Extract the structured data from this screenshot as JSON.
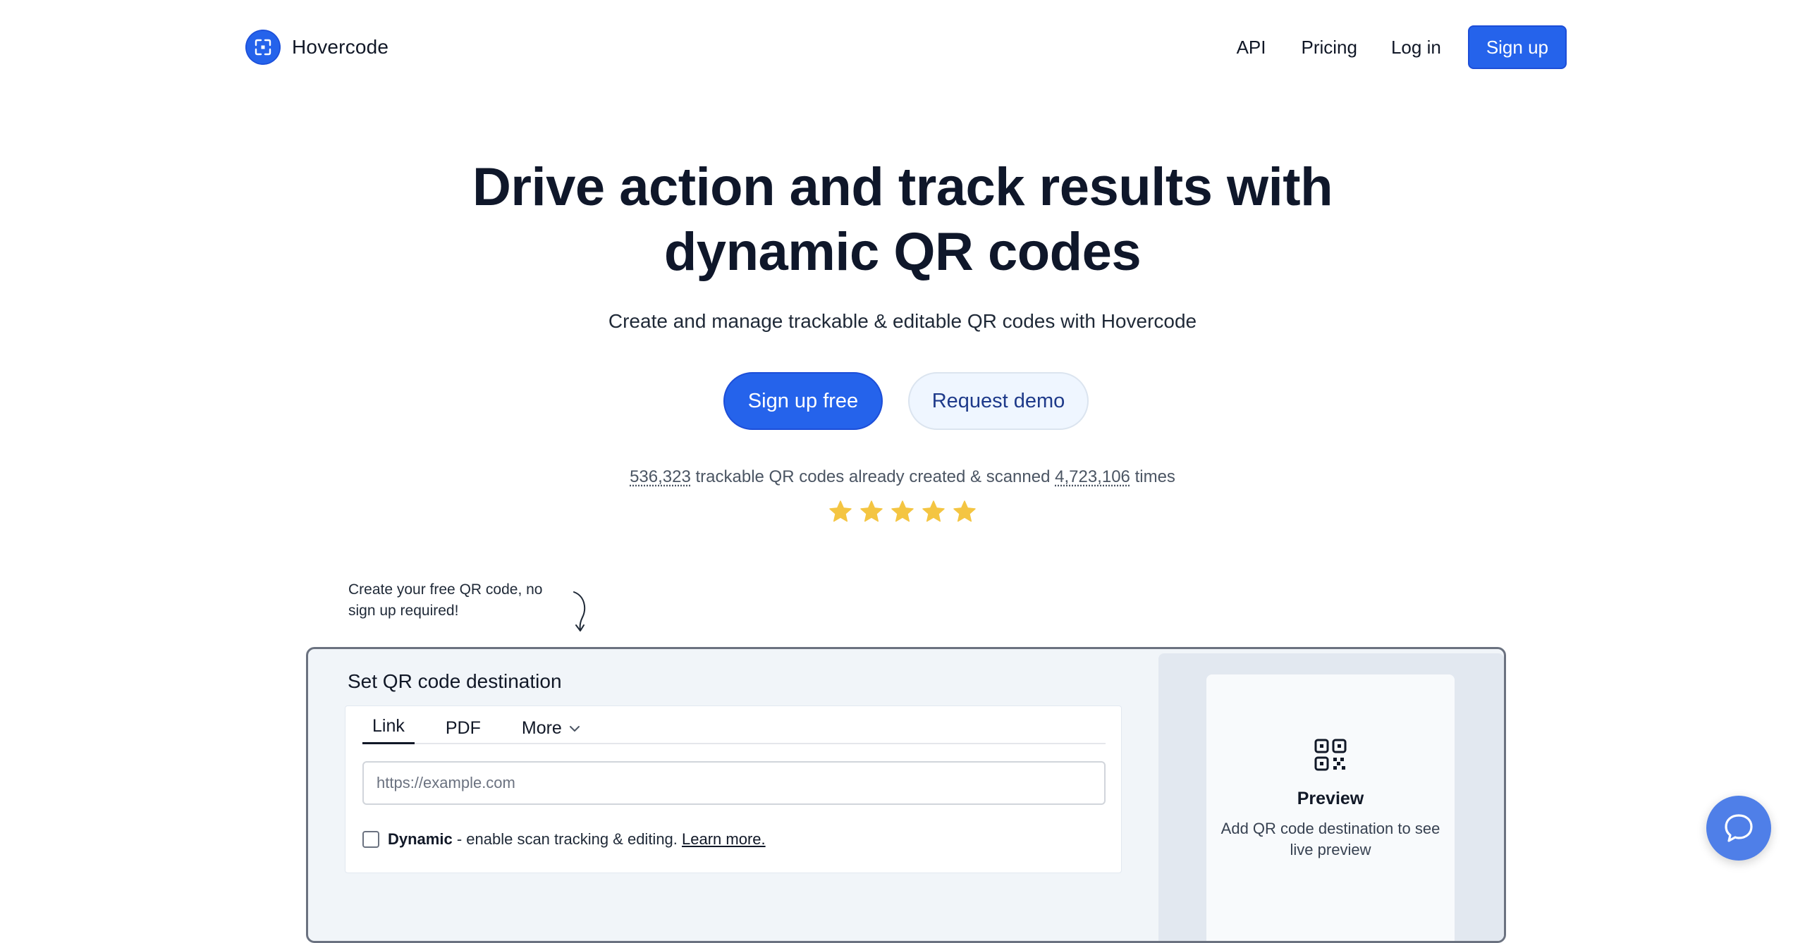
{
  "nav": {
    "brand_name": "Hovercode",
    "brand_icon": "scan-frame-icon",
    "links": [
      "API",
      "Pricing",
      "Log in"
    ],
    "signup_label": "Sign up"
  },
  "hero": {
    "title_line1": "Drive action and track results with",
    "title_line2": "dynamic QR codes",
    "subtitle": "Create and manage trackable & editable QR codes with Hovercode",
    "cta_primary": "Sign up free",
    "cta_secondary": "Request demo",
    "stats": {
      "codes_count": "536,323",
      "middle_text": "trackable QR codes already created & scanned",
      "scans_count": "4,723,106",
      "suffix": "times"
    },
    "rating_stars": 5,
    "star_color": "#f4c542"
  },
  "note": {
    "text": "Create your free QR code, no sign up required!"
  },
  "tool": {
    "title": "Set QR code destination",
    "tabs": [
      {
        "label": "Link",
        "active": true
      },
      {
        "label": "PDF",
        "active": false
      },
      {
        "label": "More",
        "active": false
      }
    ],
    "url_placeholder": "https://example.com",
    "url_value": "",
    "dynamic_label": "Dynamic",
    "dynamic_desc": " - enable scan tracking & editing. ",
    "learn_more": "Learn more.",
    "dynamic_checked": false
  },
  "preview": {
    "icon": "qr-code-icon",
    "title": "Preview",
    "description": "Add QR code destination to see live preview"
  },
  "chat": {
    "icon": "chat-bubble-icon"
  },
  "colors": {
    "accent": "#2563eb",
    "panel_bg": "#f1f5f9",
    "preview_bg": "#e2e8f0"
  }
}
